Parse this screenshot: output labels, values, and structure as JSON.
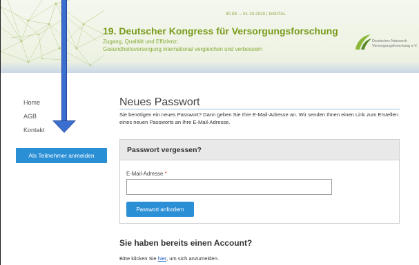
{
  "header": {
    "date": "30.09. – 01.10.2020 | DIGITAL",
    "title": "19. Deutscher Kongress für Versorgungsforschung",
    "subtitle_line1": "Zugang, Qualität und Effizienz:",
    "subtitle_line2": "Gesundheitsversorgung international vergleichen und verbessern",
    "logo_line1": "Deutsches Netzwerk",
    "logo_line2": "Versorgungsforschung e.V."
  },
  "sidebar": {
    "items": [
      {
        "label": "Home"
      },
      {
        "label": "AGB"
      },
      {
        "label": "Kontakt"
      }
    ],
    "cta_label": "Als Teilnehmer anmelden"
  },
  "main": {
    "title": "Neues Passwort",
    "intro": "Sie benötigen ein neues Passwort? Dann geben Sie Ihre E-Mail-Adresse an. Wir senden Ihnen einen Link zum Erstellen eines neuen Passworts an Ihre E-Mail-Adresse.",
    "panel_title": "Passwort vergessen?",
    "email_label": "E-Mail-Adresse",
    "required_mark": "*",
    "email_value": "",
    "submit_label": "Passwort anfordern",
    "account_title": "Sie haben bereits einen Account?",
    "login_prefix": "Bitte klicken Sie ",
    "login_link": "hier",
    "login_suffix": ", um sich anzumelden."
  },
  "colors": {
    "accent_blue": "#2b8fd6",
    "brand_green": "#7a9a1a",
    "arrow_blue": "#3a6fd0"
  }
}
